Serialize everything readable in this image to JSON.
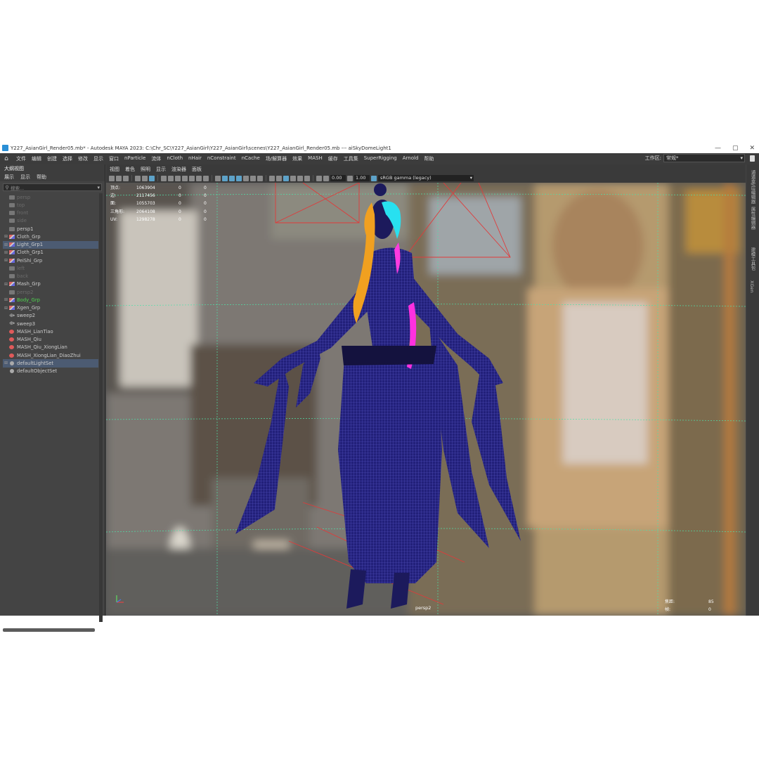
{
  "window": {
    "title": "Y227_AsianGirl_Render05.mb* - Autodesk MAYA 2023: C:\\Chr_SC\\Y227_AsianGirl\\Y227_AsianGirl\\scenes\\Y227_AsianGirl_Render05.mb  ---  aiSkyDomeLight1",
    "minimize": "—",
    "maximize": "▢",
    "close": "✕"
  },
  "menubar": {
    "items": [
      "文件",
      "编辑",
      "创建",
      "选择",
      "修改",
      "显示",
      "窗口",
      "nParticle",
      "流体",
      "nCloth",
      "nHair",
      "nConstraint",
      "nCache",
      "场/解算器",
      "效果",
      "MASH",
      "缓存",
      "工具集",
      "SuperRigging",
      "Arnold",
      "帮助"
    ],
    "workspace_label": "工作区:",
    "workspace_value": "常规*"
  },
  "outliner": {
    "title": "大纲视图",
    "menu": [
      "展示",
      "显示",
      "帮助"
    ],
    "search_placeholder": "搜索...",
    "items": [
      {
        "label": "persp",
        "icon": "camera-icon",
        "state": "hidden"
      },
      {
        "label": "top",
        "icon": "camera-icon",
        "state": "hidden"
      },
      {
        "label": "front",
        "icon": "camera-icon",
        "state": "hidden"
      },
      {
        "label": "side",
        "icon": "camera-icon",
        "state": "hidden"
      },
      {
        "label": "persp1",
        "icon": "camera-icon",
        "state": "normal"
      },
      {
        "label": "Cloth_Grp",
        "icon": "group-icon",
        "state": "normal",
        "expand": true
      },
      {
        "label": "Light_Grp1",
        "icon": "group-icon",
        "state": "selected",
        "expand": true
      },
      {
        "label": "Cloth_Grp1",
        "icon": "group-icon",
        "state": "normal",
        "expand": true
      },
      {
        "label": "PeiShi_Grp",
        "icon": "group-icon",
        "state": "normal",
        "expand": true
      },
      {
        "label": "left",
        "icon": "camera-icon",
        "state": "hidden"
      },
      {
        "label": "back",
        "icon": "camera-icon",
        "state": "hidden"
      },
      {
        "label": "Mash_Grp",
        "icon": "group-icon",
        "state": "normal",
        "expand": true
      },
      {
        "label": "persp2",
        "icon": "camera-icon",
        "state": "hidden"
      },
      {
        "label": "Body_Grp",
        "icon": "group-icon",
        "state": "green",
        "expand": true
      },
      {
        "label": "Xgen_Grp",
        "icon": "group-icon",
        "state": "normal",
        "expand": true
      },
      {
        "label": "sweep2",
        "icon": "transform-icon",
        "state": "normal"
      },
      {
        "label": "sweep3",
        "icon": "transform-icon",
        "state": "normal"
      },
      {
        "label": "MASH_LianTiao",
        "icon": "mash-icon",
        "state": "normal"
      },
      {
        "label": "MASH_Qiu",
        "icon": "mash-icon",
        "state": "normal"
      },
      {
        "label": "MASH_Qiu_XiongLian",
        "icon": "mash-icon",
        "state": "normal"
      },
      {
        "label": "MASH_XiongLian_DiaoZhui",
        "icon": "mash-icon",
        "state": "normal"
      },
      {
        "label": "defaultLightSet",
        "icon": "set-icon",
        "state": "selected",
        "expand": true
      },
      {
        "label": "defaultObjectSet",
        "icon": "set-icon",
        "state": "normal"
      }
    ]
  },
  "viewport": {
    "menu": [
      "视图",
      "着色",
      "照明",
      "显示",
      "渲染器",
      "面板"
    ],
    "exposure": "0.00",
    "gamma": "1.00",
    "color_space": "sRGB gamma (legacy)",
    "hud": [
      {
        "label": "顶点:",
        "v1": "1063904",
        "v2": "0",
        "v3": "0"
      },
      {
        "label": "边:",
        "v1": "2117456",
        "v2": "0",
        "v3": "0"
      },
      {
        "label": "面:",
        "v1": "1055703",
        "v2": "0",
        "v3": "0"
      },
      {
        "label": "三角形:",
        "v1": "2064108",
        "v2": "0",
        "v3": "0"
      },
      {
        "label": "UV:",
        "v1": "1298278",
        "v2": "0",
        "v3": "0"
      }
    ],
    "camera_name": "persp2",
    "hud_right": [
      {
        "label": "焦距:",
        "value": "85"
      },
      {
        "label": "帧:",
        "value": "0"
      }
    ]
  },
  "right_tabs": [
    "通道盒/层编辑器",
    "属性编辑器",
    "建模工具包",
    "XGen"
  ]
}
